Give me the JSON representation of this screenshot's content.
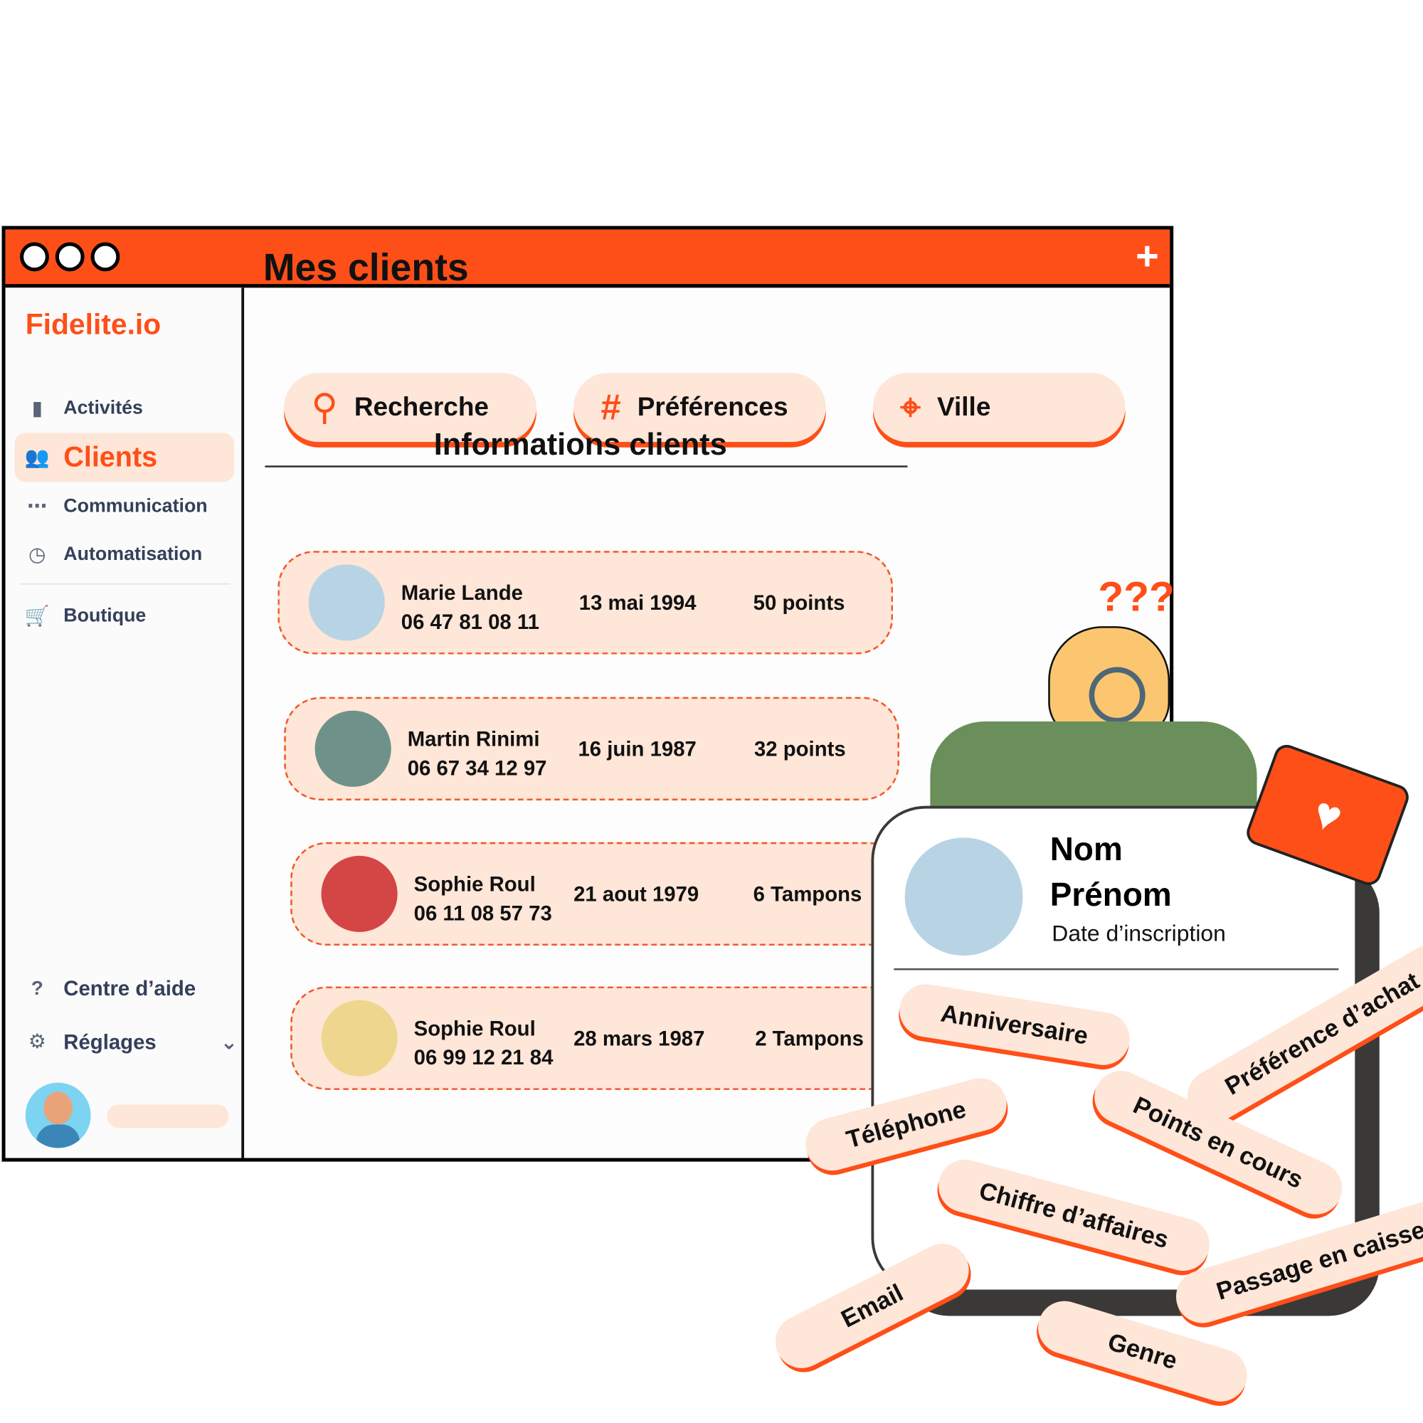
{
  "window": {
    "plus_label": "+"
  },
  "sidebar": {
    "logo": "Fidelite.io",
    "items": [
      {
        "label": "Activités",
        "icon": "bar-chart-icon"
      },
      {
        "label": "Clients",
        "icon": "users-icon",
        "active": true
      },
      {
        "label": "Communication",
        "icon": "message-icon"
      },
      {
        "label": "Automatisation",
        "icon": "clock-icon"
      },
      {
        "label": "Boutique",
        "icon": "cart-icon"
      }
    ],
    "help": "Centre d’aide",
    "settings": "Réglages"
  },
  "main": {
    "title": "Mes clients",
    "filters": [
      {
        "label": "Recherche",
        "icon": "search-icon"
      },
      {
        "label": "Préférences",
        "icon": "hashtag-icon"
      },
      {
        "label": "Ville",
        "icon": "location-pin-icon"
      }
    ],
    "section_title": "Informations clients",
    "clients": [
      {
        "name": "Marie Lande",
        "phone": "06 47 81 08 11",
        "birthdate": "13 mai 1994",
        "balance": "50 points"
      },
      {
        "name": "Martin Rinimi",
        "phone": "06 67 34 12 97",
        "birthdate": "16 juin 1987",
        "balance": "32 points"
      },
      {
        "name": "Sophie Roul",
        "phone": "06 11 08 57 73",
        "birthdate": "21 aout 1979",
        "balance": "6 Tampons"
      },
      {
        "name": "Sophie Roul",
        "phone": "06 99 12 21 84",
        "birthdate": "28 mars 1987",
        "balance": "2 Tampons"
      }
    ]
  },
  "profile_card": {
    "nom": "Nom",
    "prenom": "Prénom",
    "date": "Date d’inscription",
    "question_marks": "???",
    "tags": [
      "Anniversaire",
      "Préférence d’achat",
      "Téléphone",
      "Points en cours",
      "Chiffre d’affaires",
      "Passage en caisse",
      "Email",
      "Genre"
    ]
  },
  "colors": {
    "accent": "#fe4f18",
    "pill_bg": "#fee6d8",
    "text": "#111111",
    "nav_text": "#34405a"
  }
}
